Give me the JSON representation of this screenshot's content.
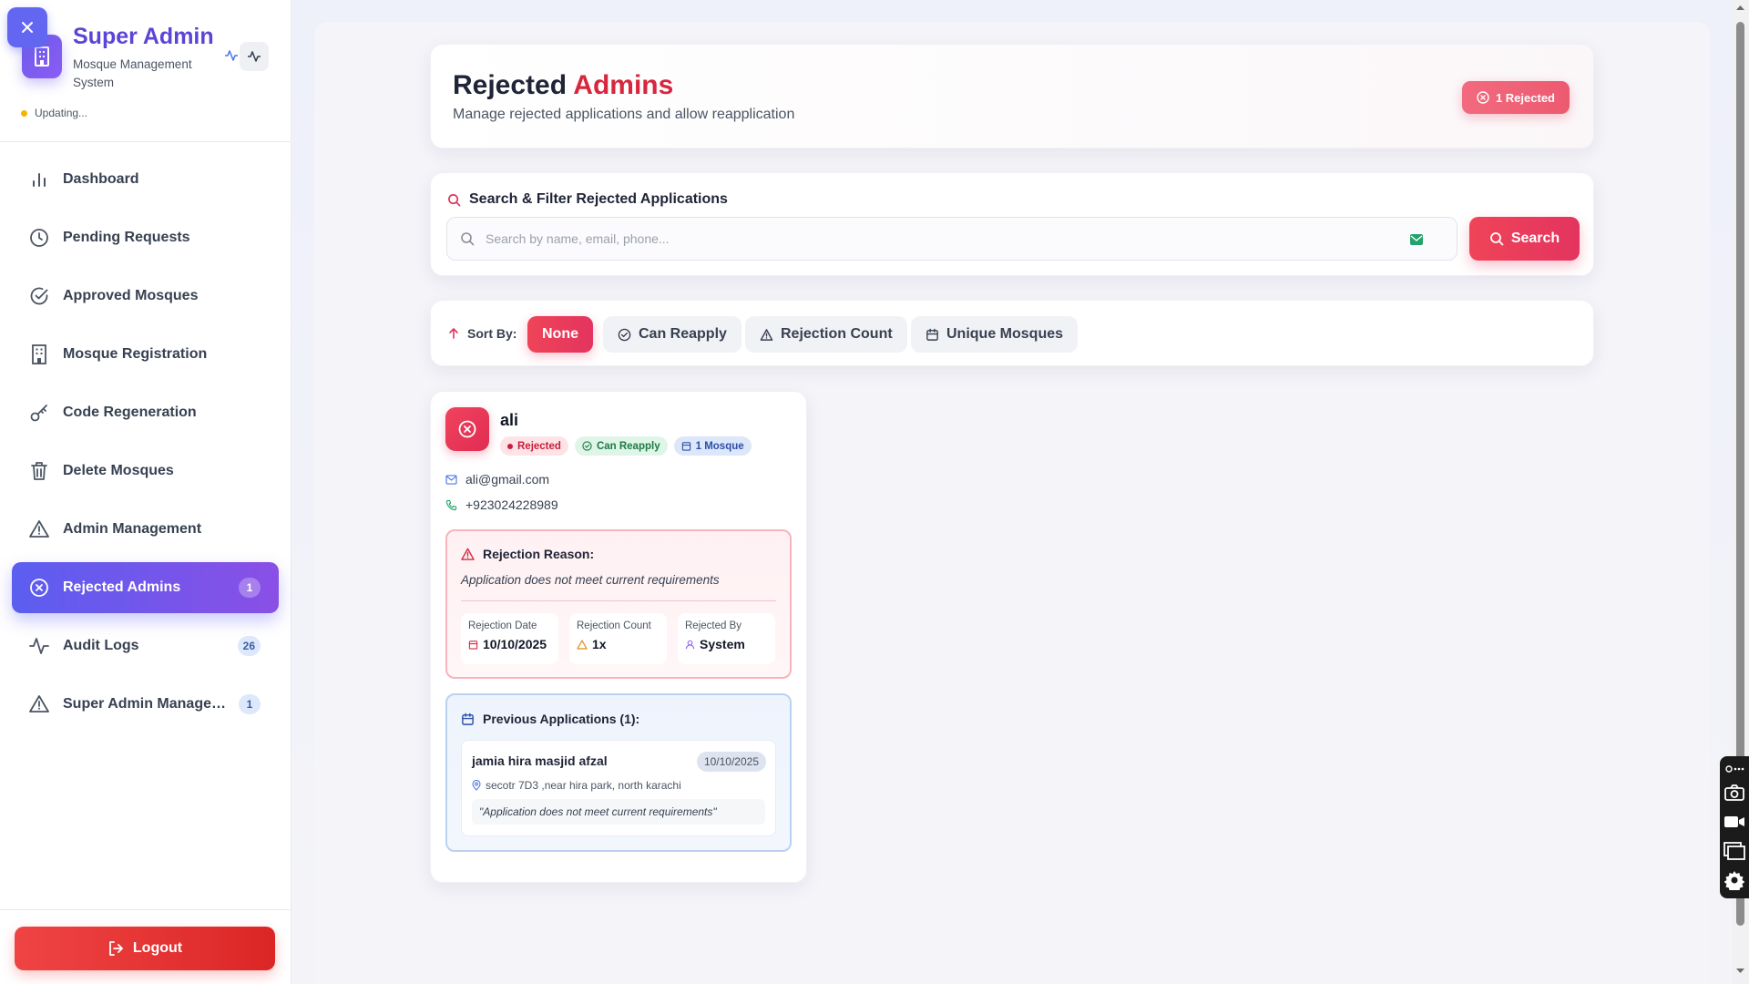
{
  "sidebar": {
    "brand_title": "Super Admin",
    "brand_subtitle": "Mosque Management System",
    "status_text": "Updating...",
    "items": [
      {
        "label": "Dashboard",
        "icon": "bar-chart-icon"
      },
      {
        "label": "Pending Requests",
        "icon": "clock-icon"
      },
      {
        "label": "Approved Mosques",
        "icon": "check-circle-icon"
      },
      {
        "label": "Mosque Registration",
        "icon": "building-icon"
      },
      {
        "label": "Code Regeneration",
        "icon": "key-icon"
      },
      {
        "label": "Delete Mosques",
        "icon": "trash-icon"
      },
      {
        "label": "Admin Management",
        "icon": "alert-triangle-icon"
      },
      {
        "label": "Rejected Admins",
        "icon": "x-circle-icon",
        "badge": "1",
        "active": true
      },
      {
        "label": "Audit Logs",
        "icon": "activity-icon",
        "badge": "26"
      },
      {
        "label": "Super Admin Managem...",
        "icon": "alert-triangle-icon",
        "badge": "1"
      }
    ],
    "logout_label": "Logout"
  },
  "header": {
    "title_prefix": "Rejected",
    "title_accent": "Admins",
    "subtitle": "Manage rejected applications and allow reapplication",
    "rejected_pill": "1 Rejected"
  },
  "search": {
    "heading": "Search & Filter Rejected Applications",
    "placeholder": "Search by name, email, phone...",
    "button_label": "Search"
  },
  "sort": {
    "label": "Sort By:",
    "options": [
      "None",
      "Can Reapply",
      "Rejection Count",
      "Unique Mosques"
    ],
    "active": "None"
  },
  "admin": {
    "name": "ali",
    "chips": {
      "status": "Rejected",
      "reapply": "Can Reapply",
      "mosques": "1 Mosque"
    },
    "email": "ali@gmail.com",
    "phone": "+923024228989",
    "rejection": {
      "title": "Rejection Reason:",
      "reason": "Application does not meet current requirements",
      "date_label": "Rejection Date",
      "date_value": "10/10/2025",
      "count_label": "Rejection Count",
      "count_value": "1x",
      "by_label": "Rejected By",
      "by_value": "System"
    },
    "previous": {
      "title": "Previous Applications (1):",
      "items": [
        {
          "name": "jamia hira masjid afzal",
          "date": "10/10/2025",
          "location": "secotr 7D3 ,near hira park, north karachi",
          "quote": "\"Application does not meet current requirements\""
        }
      ]
    }
  },
  "colors": {
    "brand": "#5b45d6",
    "active_nav": "#6366f1",
    "danger": "#e3345f",
    "success": "#1c7a45"
  }
}
